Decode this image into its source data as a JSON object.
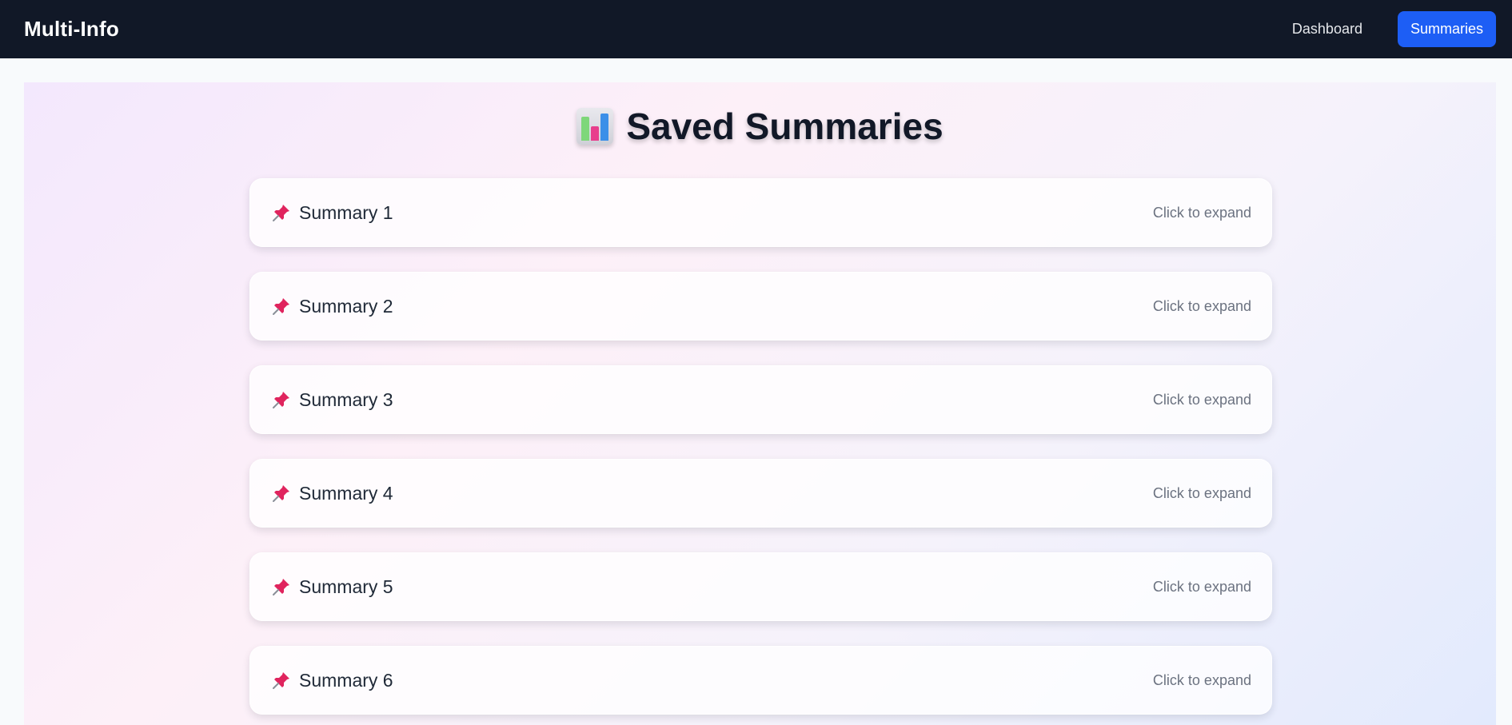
{
  "navbar": {
    "brand": "Multi-Info",
    "links": [
      {
        "label": "Dashboard",
        "active": false
      },
      {
        "label": "Summaries",
        "active": true
      }
    ]
  },
  "page": {
    "title_icon": "bar-chart-icon",
    "title": "Saved Summaries"
  },
  "summaries": [
    {
      "icon": "pushpin-icon",
      "title": "Summary 1",
      "hint": "Click to expand"
    },
    {
      "icon": "pushpin-icon",
      "title": "Summary 2",
      "hint": "Click to expand"
    },
    {
      "icon": "pushpin-icon",
      "title": "Summary 3",
      "hint": "Click to expand"
    },
    {
      "icon": "pushpin-icon",
      "title": "Summary 4",
      "hint": "Click to expand"
    },
    {
      "icon": "pushpin-icon",
      "title": "Summary 5",
      "hint": "Click to expand"
    },
    {
      "icon": "pushpin-icon",
      "title": "Summary 6",
      "hint": "Click to expand"
    }
  ],
  "colors": {
    "navbar_bg": "#111827",
    "accent": "#1d5ef5",
    "title_text": "#111827",
    "hint_text": "#6b7280",
    "pin": "#e0245e"
  }
}
